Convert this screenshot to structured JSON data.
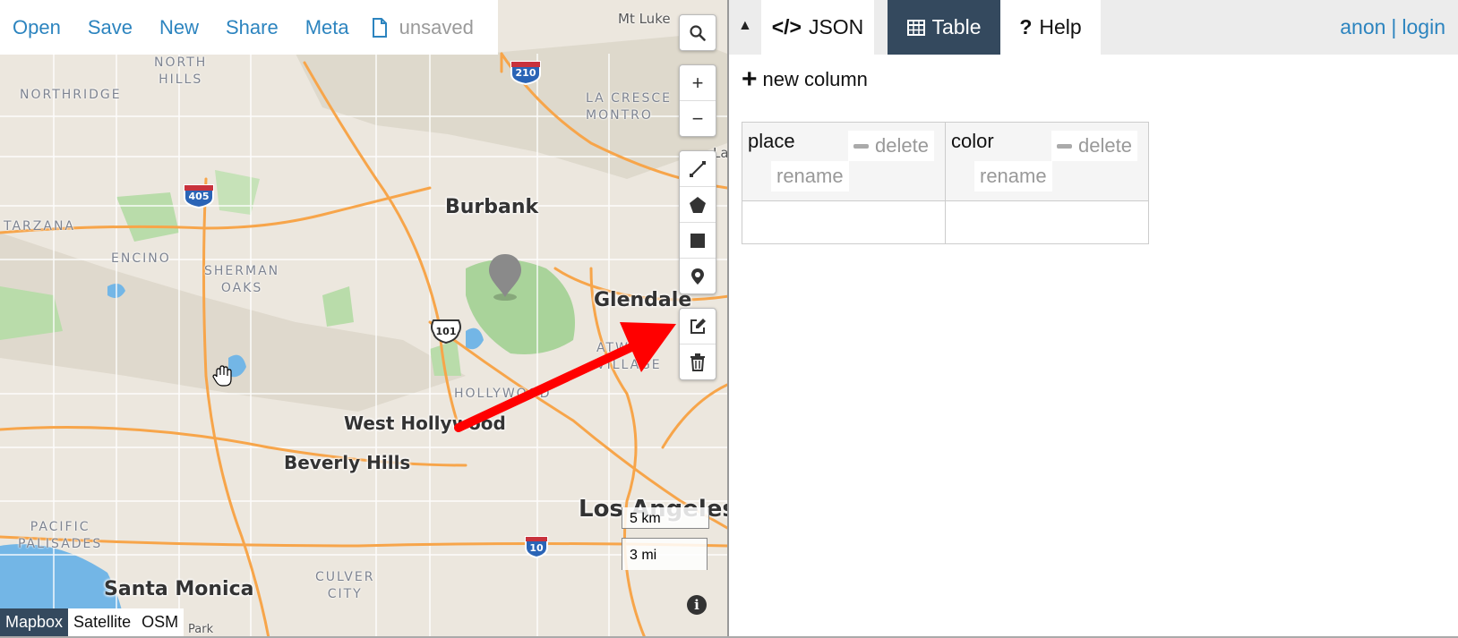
{
  "menu": {
    "open": "Open",
    "save": "Save",
    "new": "New",
    "share": "Share",
    "meta": "Meta",
    "file_status": "unsaved"
  },
  "map": {
    "cities": {
      "burbank": "Burbank",
      "glendale": "Glendale",
      "west_hollywood": "West Hollywood",
      "beverly_hills": "Beverly Hills",
      "los_angeles": "Los Angeles",
      "santa_monica": "Santa Monica"
    },
    "neighborhoods": {
      "north_hills": "NORTH\nHILLS",
      "northridge": "NORTHRIDGE",
      "tarzana": "TARZANA",
      "encino": "ENCINO",
      "sherman_oaks": "SHERMAN\nOAKS",
      "la_crescenta": "LA CRESCE\nMONTRO",
      "la_ca": "La Ca",
      "atwater": "ATWATE\nVILLAGE",
      "hollywood": "HOLLYWOOD",
      "pacific_palisades": "PACIFIC\nPALISADES",
      "culver_city": "CULVER\nCITY",
      "mt_lukens": "Mt Luke",
      "park": "Park"
    },
    "highways": [
      "210",
      "405",
      "101",
      "10"
    ],
    "scale": {
      "km": "5 km",
      "mi": "3 mi"
    },
    "layers": [
      "Mapbox",
      "Satellite",
      "OSM"
    ],
    "active_layer": "Mapbox",
    "marker_color": "#8a8a8a",
    "arrow_color": "#ff0000"
  },
  "controls": {
    "zoom_in": "+",
    "zoom_out": "−"
  },
  "panel": {
    "tabs": {
      "json": "JSON",
      "table": "Table",
      "help": "Help"
    },
    "active_tab": "Table",
    "user": {
      "anon": "anon",
      "separator": "|",
      "login": "login"
    },
    "new_column": "new column",
    "columns": [
      {
        "name": "place",
        "delete": "delete",
        "rename": "rename"
      },
      {
        "name": "color",
        "delete": "delete",
        "rename": "rename"
      }
    ]
  },
  "colors": {
    "accent": "#2c84bf",
    "active_tab_bg": "#34495e"
  }
}
